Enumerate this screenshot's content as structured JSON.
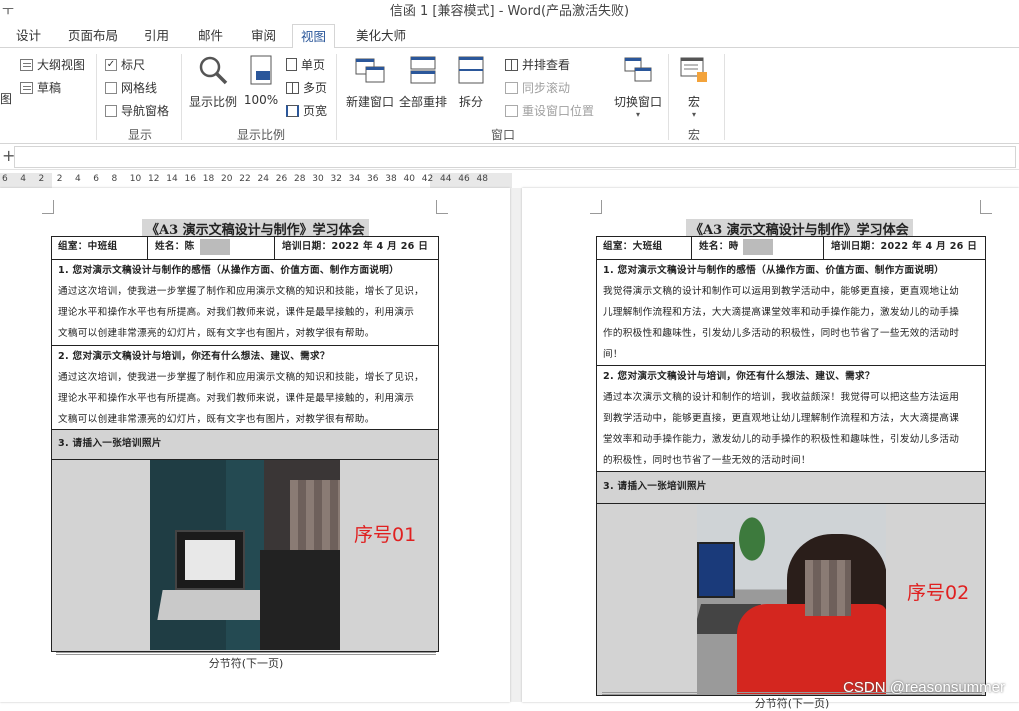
{
  "window": {
    "title": "信函 1 [兼容模式] - Word(产品激活失败)",
    "quick_access": "ㅜ"
  },
  "tabs": [
    "设计",
    "页面布局",
    "引用",
    "邮件",
    "审阅",
    "视图",
    "美化大师"
  ],
  "active_tab": "视图",
  "ribbon": {
    "views": {
      "partial_label": "图",
      "outline": "大纲视图",
      "draft": "草稿"
    },
    "show": {
      "label": "显示",
      "ruler": "标尺",
      "ruler_checked": true,
      "gridlines": "网格线",
      "gridlines_checked": false,
      "nav_pane": "导航窗格",
      "nav_pane_checked": false
    },
    "zoom": {
      "label": "显示比例",
      "zoom_btn": "显示比例",
      "percent": "100%",
      "one_page": "单页",
      "multi_page": "多页",
      "page_width": "页宽"
    },
    "window": {
      "label": "窗口",
      "new_window": "新建窗口",
      "arrange_all": "全部重排",
      "split": "拆分",
      "side_by_side": "并排查看",
      "sync_scroll": "同步滚动",
      "reset_pos": "重设窗口位置",
      "switch_windows": "切换窗口"
    },
    "macros": {
      "label": "宏",
      "macros_btn": "宏"
    }
  },
  "formula_bar": {
    "plus": "+"
  },
  "ruler": {
    "numbers": [
      "6",
      "4",
      "2",
      "2",
      "4",
      "6",
      "8",
      "10",
      "12",
      "14",
      "16",
      "18",
      "20",
      "22",
      "24",
      "26",
      "28",
      "30",
      "32",
      "34",
      "36",
      "38",
      "40",
      "42",
      "44",
      "46",
      "48"
    ]
  },
  "doc_left": {
    "title": "《A3 演示文稿设计与制作》学习体会",
    "info": {
      "group": "组室：中班组",
      "name": "姓名：陈",
      "date": "培训日期：2022 年 4 月 26 日"
    },
    "q1": "1. 您对演示文稿设计与制作的感悟（从操作方面、价值方面、制作方面说明）",
    "a1": [
      "通过这次培训，使我进一步掌握了制作和应用演示文稿的知识和技能，增长了见识，",
      "理论水平和操作水平也有所提高。对我们教师来说，课件是最早接触的，利用演示",
      "文稿可以创建非常漂亮的幻灯片，既有文字也有图片，对教学很有帮助。"
    ],
    "q2": "2. 您对演示文稿设计与培训，你还有什么想法、建议、需求？",
    "a2": [
      "通过这次培训，使我进一步掌握了制作和应用演示文稿的知识和技能，增长了见识，",
      "理论水平和操作水平也有所提高。对我们教师来说，课件是最早接触的，利用演示",
      "文稿可以创建非常漂亮的幻灯片，既有文字也有图片，对教学很有帮助。"
    ],
    "q3": "3. 请插入一张培训照片",
    "seq": "序号01",
    "section_break": "分节符(下一页)"
  },
  "doc_right": {
    "title": "《A3 演示文稿设计与制作》学习体会",
    "info": {
      "group": "组室：大班组",
      "name": "姓名：時",
      "date": "培训日期：2022 年 4 月 26 日"
    },
    "q1": "1. 您对演示文稿设计与制作的感悟（从操作方面、价值方面、制作方面说明）",
    "a1": [
      "我觉得演示文稿的设计和制作可以运用到教学活动中，能够更直接，更直观地让幼",
      "儿理解制作流程和方法，大大滴提高课堂效率和动手操作能力，激发幼儿的动手操",
      "作的积极性和趣味性，引发幼儿多活动的积极性，同时也节省了一些无效的活动时",
      "间！"
    ],
    "q2": "2. 您对演示文稿设计与培训，你还有什么想法、建议、需求？",
    "a2": [
      "通过本次演示文稿的设计和制作的培训，我收益颇深！我觉得可以把这些方法运用",
      "到教学活动中，能够更直接，更直观地让幼儿理解制作流程和方法，大大滴提高课",
      "堂效率和动手操作能力，激发幼儿的动手操作的积极性和趣味性，引发幼儿多活动",
      "的积极性，同时也节省了一些无效的活动时间！"
    ],
    "q3": "3. 请插入一张培训照片",
    "seq": "序号02",
    "section_break": "分节符(下一页)"
  },
  "watermark": "CSDN @reasonsummer"
}
